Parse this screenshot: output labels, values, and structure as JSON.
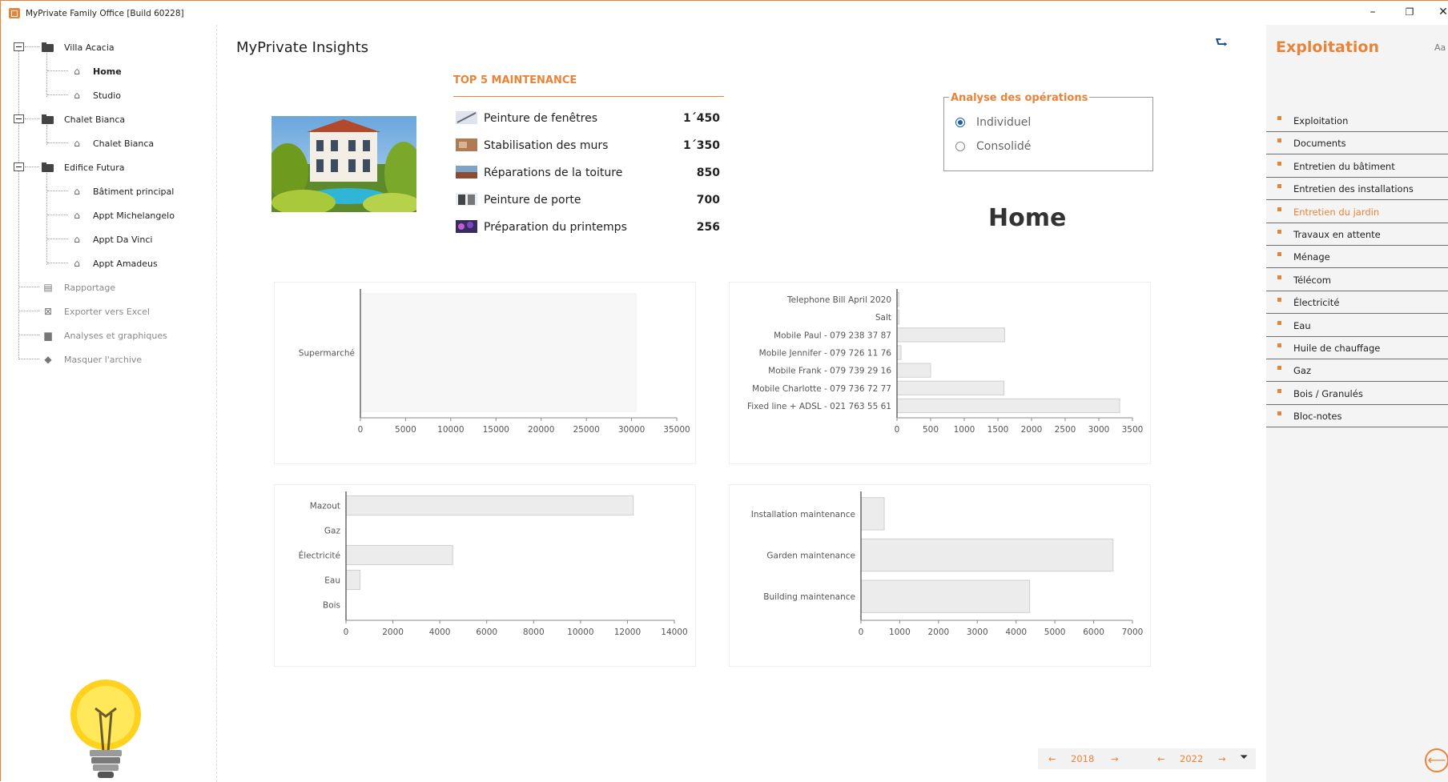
{
  "window": {
    "title": "MyPrivate Family Office [Build 60228]",
    "minimize_glyph": "–",
    "restore_glyph": "❐",
    "close_glyph": "✕"
  },
  "tree": {
    "properties": [
      {
        "label": "Villa Acacia",
        "children": [
          "Home",
          "Studio"
        ]
      },
      {
        "label": "Chalet Bianca",
        "children": [
          "Chalet Bianca"
        ]
      },
      {
        "label": "Edifice Futura",
        "children": [
          "Bâtiment principal",
          "Appt Michelangelo",
          "Appt Da Vinci",
          "Appt Amadeus"
        ]
      }
    ],
    "selected": "Home",
    "tools": [
      {
        "label": "Rapportage",
        "icon": "report-icon"
      },
      {
        "label": "Exporter vers Excel",
        "icon": "excel-icon"
      },
      {
        "label": "Analyses et graphiques",
        "icon": "bar-chart-icon"
      },
      {
        "label": "Masquer l'archive",
        "icon": "eraser-icon"
      }
    ]
  },
  "main": {
    "title": "MyPrivate Insights",
    "heading": "Home"
  },
  "top5": {
    "title": "TOP 5 MAINTENANCE",
    "items": [
      {
        "name": "Peinture de fenêtres",
        "value": "1´450"
      },
      {
        "name": "Stabilisation des murs",
        "value": "1´350"
      },
      {
        "name": "Réparations de la toiture",
        "value": "850"
      },
      {
        "name": "Peinture de porte",
        "value": "700"
      },
      {
        "name": "Préparation du printemps",
        "value": "256"
      }
    ]
  },
  "analyse": {
    "legend": "Analyse des opérations",
    "options": [
      "Individuel",
      "Consolidé"
    ],
    "selected": "Individuel"
  },
  "chart_data": [
    {
      "type": "bar",
      "orientation": "horizontal",
      "categories": [
        "Supermarché"
      ],
      "values": [
        30500
      ],
      "xlim": [
        0,
        35000
      ],
      "ticks": [
        0,
        5000,
        10000,
        15000,
        20000,
        25000,
        30000,
        35000
      ]
    },
    {
      "type": "bar",
      "orientation": "horizontal",
      "categories": [
        "Telephone Bill April 2020",
        "Salt",
        "Mobile Paul - 079 238 37 87",
        "Mobile Jennifer - 079 726 11 76",
        "Mobile Frank - 079 739 29 16",
        "Mobile Charlotte - 079 736 72 77",
        "Fixed line + ADSL - 021 763 55 61"
      ],
      "values": [
        30,
        30,
        1600,
        60,
        500,
        1590,
        3310
      ],
      "xlim": [
        0,
        3500
      ],
      "ticks": [
        0,
        500,
        1000,
        1500,
        2000,
        2500,
        3000,
        3500
      ]
    },
    {
      "type": "bar",
      "orientation": "horizontal",
      "categories": [
        "Mazout",
        "Gaz",
        "Électricité",
        "Eau",
        "Bois"
      ],
      "values": [
        12250,
        0,
        4550,
        600,
        0
      ],
      "xlim": [
        0,
        14000
      ],
      "ticks": [
        0,
        2000,
        4000,
        6000,
        8000,
        10000,
        12000,
        14000
      ]
    },
    {
      "type": "bar",
      "orientation": "horizontal",
      "categories": [
        "Installation maintenance",
        "Garden maintenance",
        "Building maintenance"
      ],
      "values": [
        600,
        6500,
        4350
      ],
      "xlim": [
        0,
        7000
      ],
      "ticks": [
        0,
        1000,
        2000,
        3000,
        4000,
        5000,
        6000,
        7000
      ]
    }
  ],
  "yearnav": {
    "from_year": "2018",
    "to_year": "2022",
    "left_arrow": "←",
    "right_arrow": "→",
    "filter_icon": "filter-icon"
  },
  "rightpanel": {
    "title": "Exploitation",
    "font_button": "Aa",
    "items": [
      "Exploitation",
      "Documents",
      "Entretien du bâtiment",
      "Entretien des installations",
      "Entretien du jardin",
      "Travaux en attente",
      "Ménage",
      "Télécom",
      "Électricité",
      "Eau",
      "Huile de chauffage",
      "Gaz",
      "Bois / Granulés",
      "Bloc-notes"
    ],
    "active": "Entretien du jardin",
    "back_glyph": "⟵"
  },
  "colors": {
    "accent": "#e8843a",
    "radio_blue": "#1a5fa8",
    "bar_fill": "#ececec",
    "bar_stroke": "#cfcfcf"
  }
}
